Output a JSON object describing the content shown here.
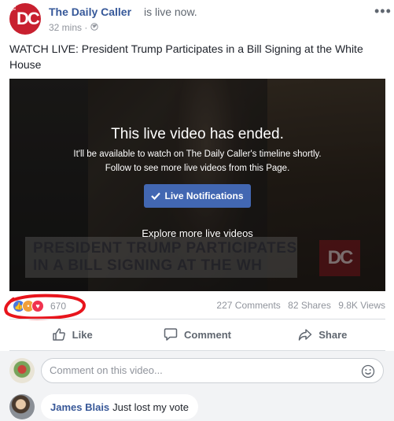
{
  "post": {
    "page_name": "The Daily Caller",
    "status_text": "is live now.",
    "timestamp": "32 mins ·",
    "more_icon": "•••",
    "text": "WATCH LIVE: President Trump Participates in a Bill Signing at the White House"
  },
  "avatar": {
    "the": "THE",
    "dc": "DC"
  },
  "video": {
    "title": "This live video has ended.",
    "subtitle_line1": "It'll be available to watch on The Daily Caller's timeline shortly.",
    "subtitle_line2": "Follow to see more live videos from this Page.",
    "button_label": "Live Notifications",
    "explore": "Explore more live videos",
    "lower_third": "PRESIDENT TRUMP PARTICIPATES IN A BILL SIGNING AT THE WH",
    "lower_logo": "DC"
  },
  "reactions": {
    "count": "670",
    "types": [
      "like",
      "angry",
      "love"
    ]
  },
  "stats": {
    "comments": "227 Comments",
    "shares": "82 Shares",
    "views": "9.8K Views"
  },
  "actions": {
    "like": "Like",
    "comment": "Comment",
    "share": "Share"
  },
  "comment_box": {
    "placeholder": "Comment on this video..."
  },
  "comment": {
    "author": "James Blais",
    "text": "Just lost my vote"
  },
  "colors": {
    "brand": "#4267b2",
    "link": "#365899",
    "annotation": "#e8141c"
  }
}
